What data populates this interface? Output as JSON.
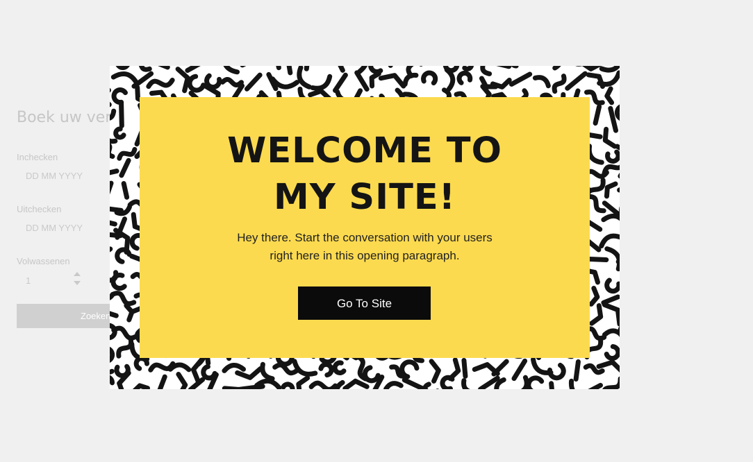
{
  "booking": {
    "title": "Boek uw verblijf",
    "checkin_label": "Inchecken",
    "checkin_placeholder": "DD MM YYYY",
    "checkout_label": "Uitchecken",
    "checkout_placeholder": "DD MM YYYY",
    "adults_label": "Volwassenen",
    "adults_value": "1",
    "search_label": "Zoeken"
  },
  "popup": {
    "heading": "WELCOME TO\nMY SITE!",
    "body": "Hey there. Start the conversation with your users\nright here in this opening paragraph.",
    "button_label": "Go To Site",
    "colors": {
      "card": "#fcda4f",
      "button": "#0b0b0b",
      "pattern": "#141414"
    }
  }
}
